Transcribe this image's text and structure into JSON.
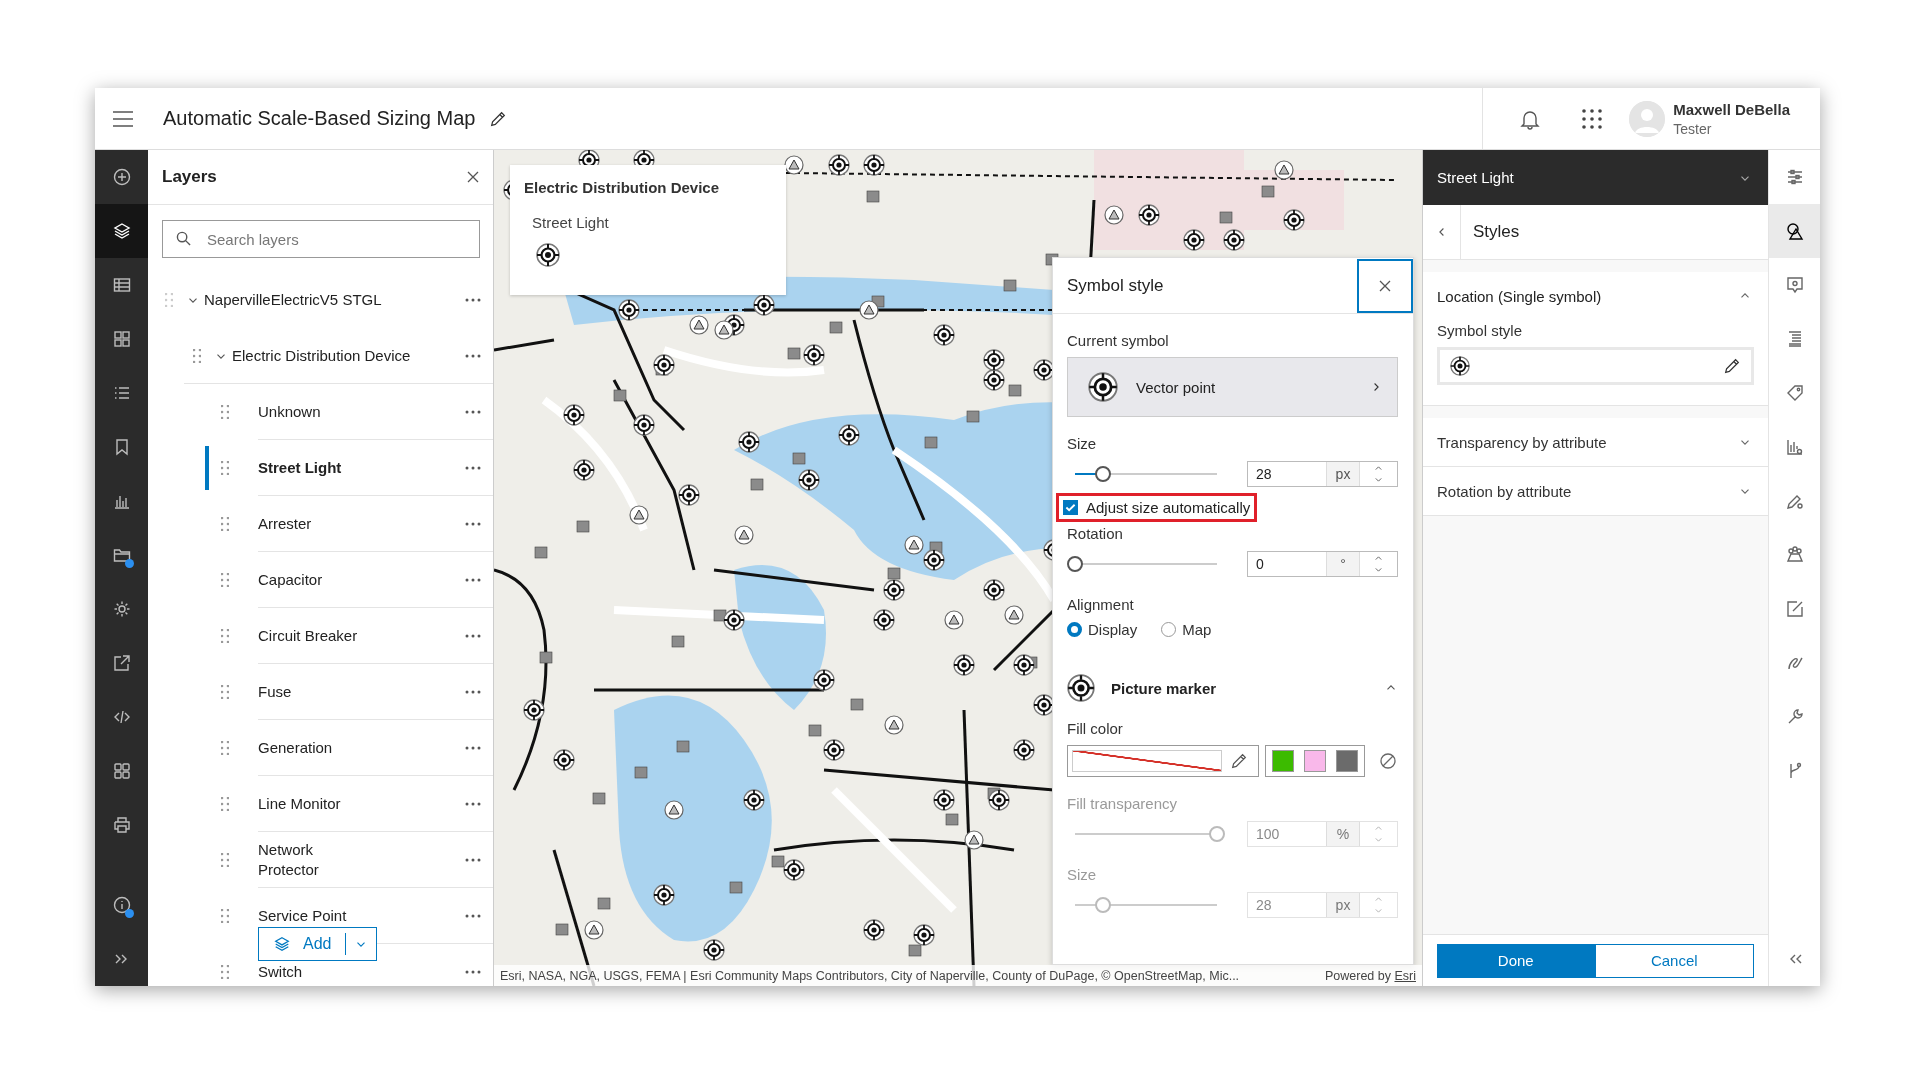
{
  "header": {
    "title": "Automatic Scale-Based Sizing Map",
    "user": {
      "name": "Maxwell DeBella",
      "role": "Tester"
    }
  },
  "left_toolbar": {
    "tools": [
      {
        "kind": "add",
        "selected": false,
        "indicator": false
      },
      {
        "kind": "layers",
        "selected": true,
        "indicator": false
      },
      {
        "kind": "table",
        "selected": false,
        "indicator": false
      },
      {
        "kind": "basemap",
        "selected": false,
        "indicator": false
      },
      {
        "kind": "legend",
        "selected": false,
        "indicator": false
      },
      {
        "kind": "bookmark",
        "selected": false,
        "indicator": false
      },
      {
        "kind": "chart",
        "selected": false,
        "indicator": false
      },
      {
        "kind": "folder",
        "selected": false,
        "indicator": true
      },
      {
        "kind": "settings",
        "selected": false,
        "indicator": false
      },
      {
        "kind": "share",
        "selected": false,
        "indicator": false
      },
      {
        "kind": "embed",
        "selected": false,
        "indicator": false
      },
      {
        "kind": "apps",
        "selected": false,
        "indicator": false
      },
      {
        "kind": "print",
        "selected": false,
        "indicator": false
      },
      {
        "kind": "info",
        "selected": false,
        "indicator": true
      },
      {
        "kind": "expand",
        "selected": false,
        "indicator": false
      }
    ]
  },
  "layers": {
    "title": "Layers",
    "search": {
      "placeholder": "Search layers"
    },
    "tree": [
      {
        "label": "NapervilleElectricV5 STGL",
        "expanded": true,
        "children": [
          {
            "label": "Electric Distribution Device",
            "expanded": true,
            "children": [
              {
                "label": "Unknown",
                "selected": false
              },
              {
                "label": "Street Light",
                "selected": true
              },
              {
                "label": "Arrester",
                "selected": false
              },
              {
                "label": "Capacitor",
                "selected": false
              },
              {
                "label": "Circuit Breaker",
                "selected": false
              },
              {
                "label": "Fuse",
                "selected": false
              },
              {
                "label": "Generation",
                "selected": false
              },
              {
                "label": "Line Monitor",
                "selected": false
              },
              {
                "label": "Network Protector",
                "selected": false
              },
              {
                "label": "Service Point",
                "selected": false
              },
              {
                "label": "Switch",
                "selected": false
              }
            ]
          }
        ]
      }
    ],
    "add_button": "Add"
  },
  "map": {
    "popup": {
      "title": "Electric Distribution Device",
      "subtitle": "Street Light"
    },
    "attribution": "Esri, NASA, NGA, USGS, FEMA | Esri Community Maps Contributors, City of Naperville, County of DuPage, © OpenStreetMap, Mic...",
    "powered_by": "Powered by",
    "powered_link": "Esri"
  },
  "symbol_style": {
    "title": "Symbol style",
    "current_symbol_label": "Current symbol",
    "current_symbol": "Vector point",
    "size": {
      "label": "Size",
      "value": "28",
      "unit": "px",
      "level": 0.2,
      "disabled": false
    },
    "adjust": {
      "label": "Adjust size automatically",
      "checked": true,
      "highlighted": true
    },
    "rotation": {
      "label": "Rotation",
      "value": "0",
      "unit": "°",
      "level": 0,
      "disabled": false
    },
    "alignment": {
      "label": "Alignment",
      "options": [
        {
          "label": "Display",
          "selected": true
        },
        {
          "label": "Map",
          "selected": false
        }
      ]
    },
    "marker": {
      "label": "Picture marker",
      "expanded": true
    },
    "fill_color": {
      "label": "Fill color",
      "swatches": [
        {
          "color": "#3cbb00"
        },
        {
          "color": "#f9b8ea"
        },
        {
          "color": "#6b6b6b"
        }
      ]
    },
    "fill_transparency": {
      "label": "Fill transparency",
      "value": "100",
      "unit": "%",
      "level": 1,
      "disabled": true
    },
    "marker_size": {
      "label": "Size",
      "value": "28",
      "unit": "px",
      "level": 0.2,
      "disabled": true
    }
  },
  "styles_panel": {
    "layer": "Street Light",
    "title": "Styles",
    "sections": [
      {
        "title": "Location (Single symbol)",
        "expanded": true,
        "field_label": "Symbol style"
      },
      {
        "title": "Transparency by attribute",
        "expanded": false
      },
      {
        "title": "Rotation by attribute",
        "expanded": false
      }
    ],
    "buttons": {
      "done": "Done",
      "cancel": "Cancel"
    }
  },
  "right_toolbar": {
    "tools": [
      {
        "kind": "properties",
        "selected": false
      },
      {
        "kind": "styles",
        "selected": true
      },
      {
        "kind": "popups",
        "selected": false
      },
      {
        "kind": "fields",
        "selected": false
      },
      {
        "kind": "labels",
        "selected": false
      },
      {
        "kind": "charts",
        "selected": false
      },
      {
        "kind": "edit-settings",
        "selected": false
      },
      {
        "kind": "clustering",
        "selected": false
      },
      {
        "kind": "forms",
        "selected": false
      },
      {
        "kind": "sketch",
        "selected": false
      },
      {
        "kind": "tools",
        "selected": false
      },
      {
        "kind": "branch",
        "selected": false
      },
      {
        "kind": "collapse",
        "selected": false
      }
    ]
  }
}
